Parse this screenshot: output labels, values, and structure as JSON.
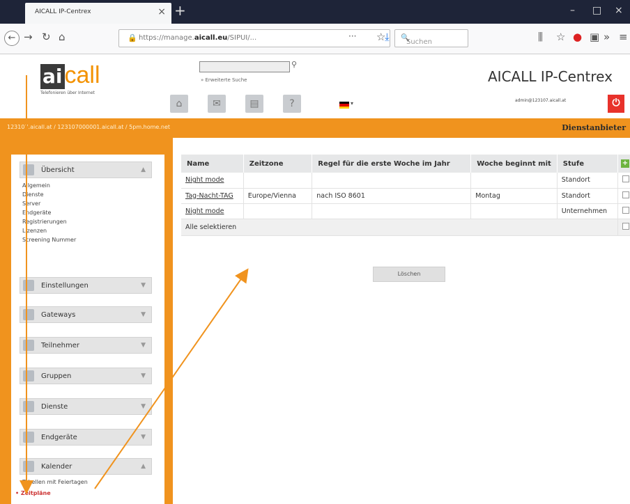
{
  "browser": {
    "tab_title": "AICALL IP-Centrex",
    "tab_close": "×",
    "new_tab": "+",
    "url_prefix": "https://manage.",
    "url_domain": "aicall.eu",
    "url_suffix": "/SIPUI/...",
    "search_placeholder": "Suchen"
  },
  "app": {
    "logo_ai": "ai",
    "logo_call": "call",
    "logo_subtitle": "Telefonieren über Internet",
    "advanced_search": "» Erweiterte Suche",
    "title": "AICALL IP-Centrex",
    "user": "admin@123107.aicall.at",
    "breadcrumb": "123107.aicall.at / 123107000001.aicall.at / 5pm.home.net",
    "provider": "Dienstanbieter"
  },
  "sidebar": {
    "sections": [
      {
        "label": "Übersicht",
        "icon": "overview-icon",
        "items": [
          "Allgemein",
          "Dienste",
          "Server",
          "Endgeräte",
          "Registrierungen",
          "Lizenzen",
          "Screening Nummer"
        ]
      },
      {
        "label": "Einstellungen",
        "icon": "settings-icon",
        "items": []
      },
      {
        "label": "Gateways",
        "icon": "gateway-icon",
        "items": []
      },
      {
        "label": "Teilnehmer",
        "icon": "users-icon",
        "items": []
      },
      {
        "label": "Gruppen",
        "icon": "groups-icon",
        "items": []
      },
      {
        "label": "Dienste",
        "icon": "services-icon",
        "items": []
      },
      {
        "label": "Endgeräte",
        "icon": "devices-icon",
        "items": []
      },
      {
        "label": "Kalender",
        "icon": "calendar-icon",
        "items": [
          "Tabellen mit Feiertagen",
          "• Zeitpläne"
        ]
      }
    ]
  },
  "table": {
    "headers": [
      "Name",
      "Zeitzone",
      "Regel für die erste Woche im Jahr",
      "Woche beginnt mit",
      "Stufe"
    ],
    "rows": [
      [
        "Night mode",
        "",
        "",
        "",
        "Standort"
      ],
      [
        "Tag-Nacht-TAG",
        "Europe/Vienna",
        "nach ISO 8601",
        "Montag",
        "Standort"
      ],
      [
        "Night mode",
        "",
        "",
        "",
        "Unternehmen"
      ]
    ],
    "select_all": "Alle selektieren",
    "delete_label": "Löschen"
  },
  "colors": {
    "accent": "#f0931e",
    "power": "#e8322b",
    "logo_orange": "#f39200"
  }
}
